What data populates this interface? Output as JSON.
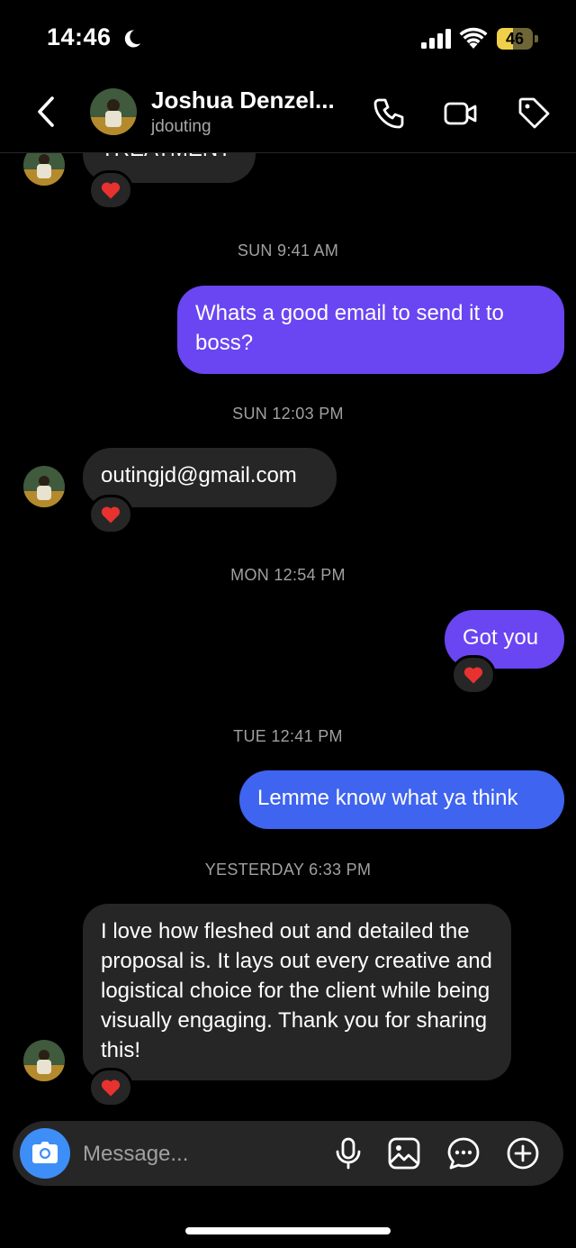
{
  "status_bar": {
    "time": "14:46",
    "battery_level": "46",
    "battery_percent": 46,
    "icons": [
      "moon-icon",
      "cellular-signal-icon",
      "wifi-icon",
      "battery-icon"
    ]
  },
  "header": {
    "contact_name": "Joshua Denzel...",
    "contact_handle": "jdouting",
    "icons": [
      "back-icon",
      "phone-icon",
      "video-icon",
      "tag-icon"
    ]
  },
  "messages": [
    {
      "type": "incoming",
      "text": "TREATMENT",
      "reaction": "❤️"
    },
    {
      "type": "timestamp",
      "text": "SUN 9:41 AM"
    },
    {
      "type": "outgoing",
      "text": "Whats a good email to send it to boss?"
    },
    {
      "type": "timestamp",
      "text": "SUN 12:03 PM"
    },
    {
      "type": "incoming",
      "text": "outingjd@gmail.com",
      "reaction": "❤️"
    },
    {
      "type": "timestamp",
      "text": "MON 12:54 PM"
    },
    {
      "type": "outgoing",
      "text": "Got you",
      "reaction": "❤️"
    },
    {
      "type": "timestamp",
      "text": "TUE 12:41 PM"
    },
    {
      "type": "outgoing",
      "text": "Lemme know what ya think"
    },
    {
      "type": "timestamp",
      "text": "YESTERDAY 6:33 PM"
    },
    {
      "type": "incoming",
      "text": "I love how fleshed out and detailed the proposal is. It lays out every creative and logistical choice for the client while being visually engaging. Thank you for sharing this!",
      "reaction": "❤️"
    }
  ],
  "composer": {
    "placeholder": "Message...",
    "icons": [
      "camera-icon",
      "microphone-icon",
      "gallery-icon",
      "sticker-icon",
      "plus-icon"
    ]
  },
  "colors": {
    "background": "#000000",
    "incoming_bubble": "#262626",
    "outgoing_purple": "#6a45f2",
    "outgoing_blue": "#3f64f0",
    "camera_button": "#3e8ef7",
    "battery": "#f0d04a"
  }
}
